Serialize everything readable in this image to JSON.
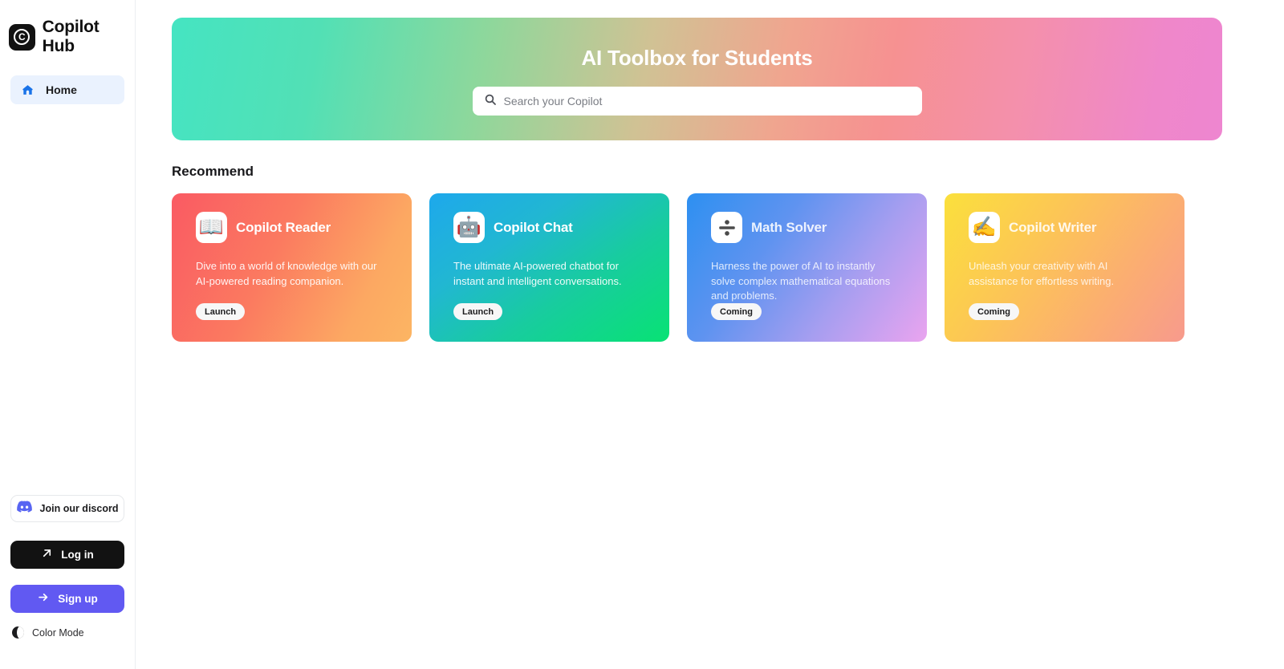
{
  "sidebar": {
    "logo": {
      "mark_letter": "C",
      "text": "Copilot Hub",
      "icon": "copilot-hub-logo"
    },
    "nav": [
      {
        "label": "Home",
        "icon": "home-icon",
        "active": true
      }
    ],
    "discord": {
      "label": "Join our discord",
      "icon": "discord-icon",
      "color": "#5865f2"
    },
    "login": {
      "label": "Log in",
      "icon": "arrow-up-right-icon",
      "bg": "#121212"
    },
    "signup": {
      "label": "Sign up",
      "icon": "arrow-right-icon",
      "bg": "#6159f2"
    },
    "color_mode": {
      "label": "Color Mode",
      "icon": "moon-icon"
    }
  },
  "hero": {
    "title": "AI Toolbox for Students",
    "gradient_from": "#45e4c2",
    "gradient_to": "#ee86d0"
  },
  "search": {
    "placeholder": "Search your Copilot",
    "value": "",
    "icon": "search-icon"
  },
  "main": {
    "section_title": "Recommend"
  },
  "cards": [
    {
      "title": "Copilot Reader",
      "description": "Dive into a world of knowledge with our AI-powered reading companion.",
      "button": "Launch",
      "icon": "open-book-icon",
      "emoji": "📖",
      "gradient_from": "#fa5d63",
      "gradient_to": "#fcb261"
    },
    {
      "title": "Copilot Chat",
      "description": "The ultimate AI-powered chatbot for instant and intelligent conversations.",
      "button": "Launch",
      "icon": "robot-icon",
      "emoji": "🤖",
      "gradient_from": "#1fa6ea",
      "gradient_to": "#09e07a"
    },
    {
      "title": "Math Solver",
      "description": "Harness the power of AI to instantly solve complex mathematical equations and problems.",
      "button": "Coming",
      "icon": "division-sign-icon",
      "emoji": "➗",
      "gradient_from": "#2f93f0",
      "gradient_to": "#e9a3ef"
    },
    {
      "title": "Copilot Writer",
      "description": "Unleash your creativity with AI assistance for effortless writing.",
      "button": "Coming",
      "icon": "writing-hand-icon",
      "emoji": "✍️",
      "gradient_from": "#fbdf3e",
      "gradient_to": "#f79a8c"
    }
  ]
}
